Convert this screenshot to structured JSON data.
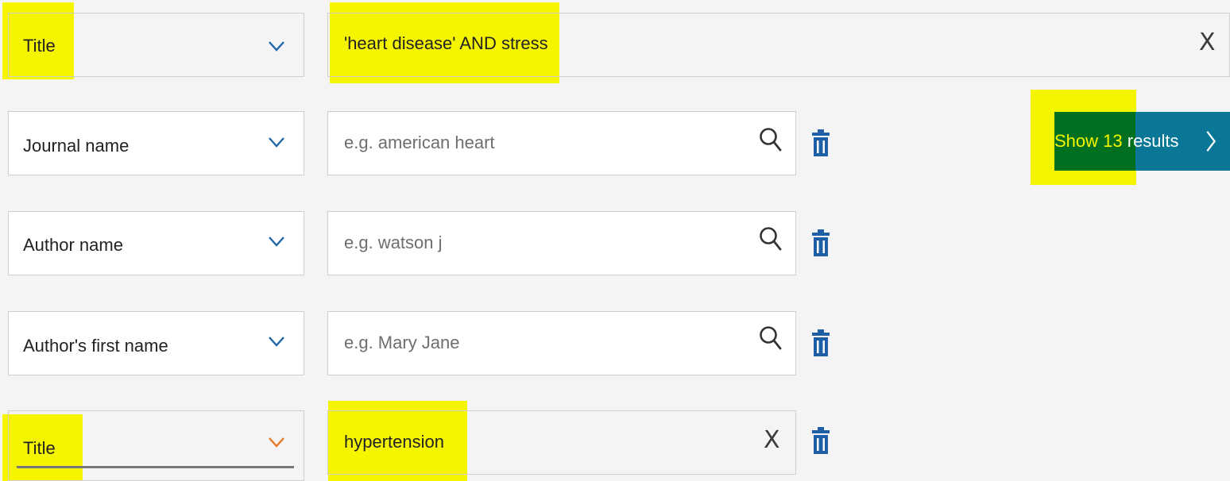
{
  "rows": [
    {
      "field": "Title",
      "value": "'heart disease' AND stress",
      "placeholder": ""
    },
    {
      "field": "Journal name",
      "value": "",
      "placeholder": "e.g. american heart"
    },
    {
      "field": "Author name",
      "value": "",
      "placeholder": "e.g. watson j"
    },
    {
      "field": "Author's first name",
      "value": "",
      "placeholder": "e.g. Mary Jane"
    },
    {
      "field": "Title",
      "value": "hypertension",
      "placeholder": ""
    }
  ],
  "clear_icon": "X",
  "results_button": {
    "prefix": "Show 13",
    "suffix": " results"
  },
  "icons": {
    "chevron": "chevron-down-icon",
    "search": "search-icon",
    "delete": "trash-icon",
    "clear": "close-icon",
    "next": "chevron-right-icon"
  },
  "colors": {
    "chevron_default": "#1f66a8",
    "chevron_active": "#e87722",
    "trash": "#1f5fa8",
    "highlight": "#f5f500",
    "button": "#0b7796",
    "button_highlight": "#006f1f"
  }
}
